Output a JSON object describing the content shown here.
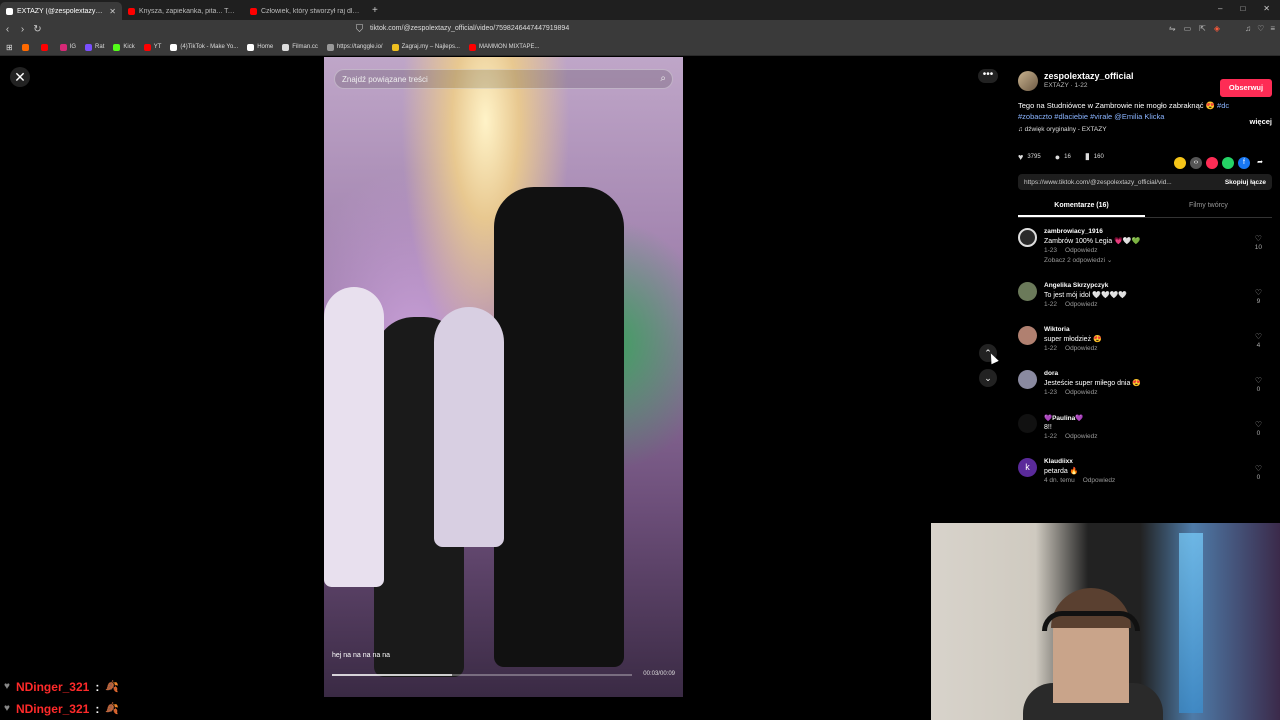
{
  "browser": {
    "tabs": [
      {
        "label": "EXTAZY (@zespolextazy_offic",
        "fav_color": "#ffffff",
        "active": true
      },
      {
        "label": "Knysza, zapiekanka, pita... Tak jadła",
        "fav_color": "#ff0000",
        "active": false
      },
      {
        "label": "Człowiek, który stworzył raj dla PDF",
        "fav_color": "#ff0000",
        "active": false
      }
    ],
    "new_tab": "+",
    "window_controls": [
      "–",
      "□",
      "✕"
    ],
    "url": "tiktok.com/@zespolextazy_official/video/7598246447447919894",
    "bookmarks": [
      {
        "label": "",
        "color": "#ff6a00"
      },
      {
        "label": "",
        "color": "#ff0000"
      },
      {
        "label": "IG",
        "color": "#d62976"
      },
      {
        "label": "Rat",
        "color": "#7a4fff"
      },
      {
        "label": "Kick",
        "color": "#53fc18"
      },
      {
        "label": "YT",
        "color": "#ff0000"
      },
      {
        "label": "(4)TikTok - Make Yo...",
        "color": "#ffffff"
      },
      {
        "label": "Home",
        "color": "#ffffff"
      },
      {
        "label": "Filman.cc",
        "color": "#dddddd"
      },
      {
        "label": "https://tanggle.io/",
        "color": "#999999"
      },
      {
        "label": "Zagraj.my – Najleps...",
        "color": "#f0c020"
      },
      {
        "label": "MAMMON MIXTAPE...",
        "color": "#ff0000"
      }
    ]
  },
  "video": {
    "search_placeholder": "Znajdź powiązane treści",
    "caption": "hej na na na na na",
    "time": "00:03/00:09",
    "progress": 0.4
  },
  "panel": {
    "author": "zespolextazy_official",
    "author_sub": "EXTAZY · 1-22",
    "follow": "Obserwuj",
    "desc_text": "Tego na Studniówce w Zambrowie nie mogło zabraknąć 😍",
    "desc_tags": "#dc #zobaczto #dlaciebie #virale @Emilia Klicka",
    "more": "więcej",
    "sound": "♫  dźwięk oryginalny - EXTAZY",
    "likes": "3795",
    "comments_count": "16",
    "saves": "160",
    "link": "https://www.tiktok.com/@zespolextazy_official/vid...",
    "copy": "Skopiuj łącze",
    "tab_comments": "Komentarze (16)",
    "tab_creator": "Filmy twórcy",
    "comments": [
      {
        "name": "zambrowiacy_1916",
        "text": "Zambrów 100% Legia 💗🤍💚",
        "date": "1-23",
        "reply": "Odpowiedz",
        "likes": "10",
        "av": "#2a2a2a",
        "replies": "Zobacz 2 odpowiedzi ⌄"
      },
      {
        "name": "Angelika Skrzypczyk",
        "text": "To jest mój idol 🤍🤍🤍🤍",
        "date": "1-22",
        "reply": "Odpowiedz",
        "likes": "9",
        "av": "#6b7a5a",
        "replies": ""
      },
      {
        "name": "Wiktoria",
        "text": "super młodzież 😍",
        "date": "1-22",
        "reply": "Odpowiedz",
        "likes": "4",
        "av": "#b08070",
        "replies": ""
      },
      {
        "name": "dora",
        "text": "Jesteście super miłego dnia 😍",
        "date": "1-23",
        "reply": "Odpowiedz",
        "likes": "0",
        "av": "#8a8aa0",
        "replies": ""
      },
      {
        "name": "💜Paulina💜",
        "text": "8!!",
        "date": "1-22",
        "reply": "Odpowiedz",
        "likes": "0",
        "av": "#111111",
        "replies": ""
      },
      {
        "name": "Klaudiixx",
        "text": "petarda 🔥",
        "date": "4 dn. temu",
        "reply": "Odpowiedz",
        "likes": "0",
        "av": "#5a2a9a",
        "replies": ""
      }
    ]
  },
  "chat": [
    {
      "user": "NDinger_321",
      "emote": "🍂"
    },
    {
      "user": "NDinger_321",
      "emote": "🍂"
    }
  ]
}
